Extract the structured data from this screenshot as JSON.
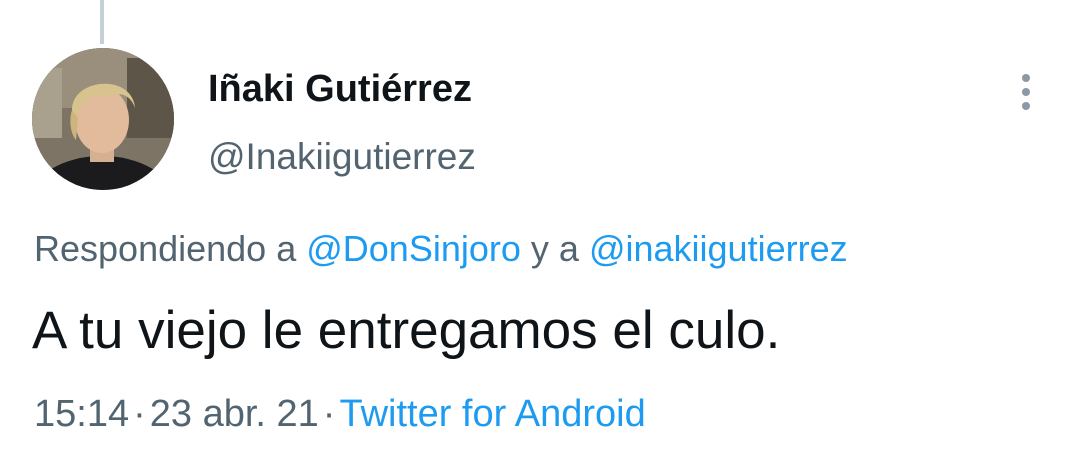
{
  "tweet": {
    "display_name": "Iñaki Gutiérrez",
    "handle": "@Inakiigutierrez",
    "reply": {
      "prefix": "Respondiendo a",
      "mention_1": "@DonSinjoro",
      "joiner": "y a",
      "mention_2": "@inakiigutierrez"
    },
    "text": "A tu viejo le entregamos el culo.",
    "time": "15:14",
    "date": "23 abr. 21",
    "source": "Twitter for Android",
    "separator": "·"
  },
  "icons": {
    "more": "more-vertical-icon",
    "avatar": "user-avatar"
  },
  "colors": {
    "link": "#1d9bf0",
    "secondary_text": "#536471",
    "primary_text": "#0f1419",
    "thread_line": "#c4cfd6"
  }
}
